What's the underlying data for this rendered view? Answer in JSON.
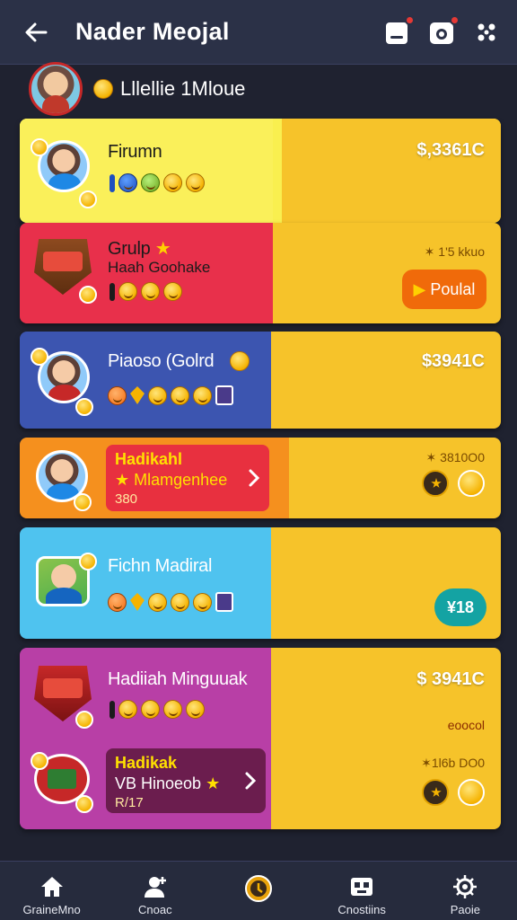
{
  "header": {
    "title": "Nader Meojal"
  },
  "profile": {
    "name": "Lllellie 1Mloue"
  },
  "cards": [
    {
      "name": "Firumn",
      "price": "$,3361C"
    },
    {
      "name": "Grulp",
      "subtitle": "Haah Goohake",
      "price": "✶ 1'5 kkuo",
      "button": "Poulal"
    },
    {
      "name": "Piaoso (Golrd",
      "price": "$3941C"
    },
    {
      "promo_title": "Hadikahl",
      "promo_subtitle": "Mlamgenhee",
      "promo_number": "380",
      "price": "✶ 3810O0"
    },
    {
      "name": "Fichn Madiral",
      "button": "¥18"
    },
    {
      "name": "Hadiiah Minguuak",
      "price": "$ 3941C",
      "tag": "eoocol",
      "promo_title": "Hadikak",
      "promo_subtitle": "VB Hinoeob",
      "promo_number": "R/17",
      "price2": "✶1l6b DO0"
    }
  ],
  "nav": [
    {
      "label": "GraineMno",
      "icon": "home-icon"
    },
    {
      "label": "Cnoac",
      "icon": "user-icon"
    },
    {
      "label": "",
      "icon": "coin-icon"
    },
    {
      "label": "Cnostiins",
      "icon": "gift-icon"
    },
    {
      "label": "Paoie",
      "icon": "settings-icon"
    }
  ]
}
